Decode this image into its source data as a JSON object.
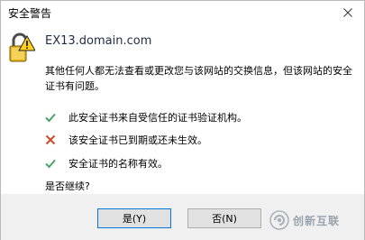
{
  "window": {
    "title": "安全警告"
  },
  "dialog": {
    "host": "EX13.domain.com",
    "message": "其他任何人都无法查看或更改您与该网站的交换信息，但该网站的安全证书有问题。",
    "cert_checks": [
      {
        "status": "ok",
        "text": "此安全证书来自受信任的证书验证机构。"
      },
      {
        "status": "error",
        "text": "该安全证书已到期或还未生效。"
      },
      {
        "status": "ok",
        "text": "安全证书的名称有效。"
      }
    ],
    "question": "是否继续?"
  },
  "buttons": {
    "yes_label": "是(Y)",
    "no_label": "否(N)"
  },
  "watermark": {
    "text": "创新互联"
  },
  "colors": {
    "ok": "#4aa36a",
    "error": "#d24a2b",
    "lock_yellow": "#f5c518"
  },
  "icons": {
    "lock": "lock-warning-icon",
    "ok": "checkmark-icon",
    "error": "x-mark-icon",
    "close": "close-icon"
  }
}
